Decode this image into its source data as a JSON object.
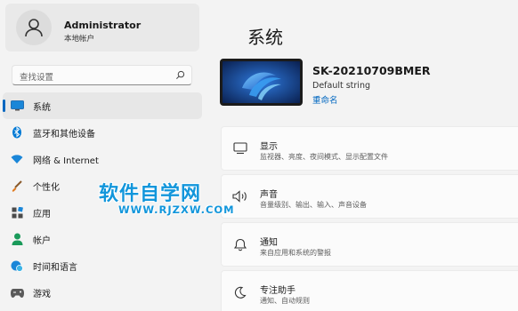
{
  "account": {
    "name": "Administrator",
    "type": "本地帐户"
  },
  "search": {
    "placeholder": "查找设置"
  },
  "nav": {
    "items": [
      {
        "label": "系统",
        "icon": "monitor-icon",
        "active": true
      },
      {
        "label": "蓝牙和其他设备",
        "icon": "bluetooth-icon",
        "active": false
      },
      {
        "label": "网络 & Internet",
        "icon": "wifi-icon",
        "active": false
      },
      {
        "label": "个性化",
        "icon": "brush-icon",
        "active": false
      },
      {
        "label": "应用",
        "icon": "apps-icon",
        "active": false
      },
      {
        "label": "帐户",
        "icon": "person-icon",
        "active": false
      },
      {
        "label": "时间和语言",
        "icon": "globe-clock-icon",
        "active": false
      },
      {
        "label": "游戏",
        "icon": "gamepad-icon",
        "active": false
      }
    ]
  },
  "main": {
    "title": "系统",
    "device": {
      "name": "SK-20210709BMER",
      "description": "Default string",
      "rename_label": "重命名"
    },
    "cards": [
      {
        "title": "显示",
        "subtitle": "监视器、亮度、夜间模式、显示配置文件",
        "icon": "display-icon"
      },
      {
        "title": "声音",
        "subtitle": "音量级别、输出、输入、声音设备",
        "icon": "speaker-icon"
      },
      {
        "title": "通知",
        "subtitle": "来自应用和系统的警报",
        "icon": "bell-icon"
      },
      {
        "title": "专注助手",
        "subtitle": "通知、自动规则",
        "icon": "moon-icon"
      }
    ]
  },
  "watermark": {
    "title": "软件自学网",
    "url": "WWW.RJZXW.COM"
  },
  "colors": {
    "accent": "#0067c0",
    "watermark": "#1296db",
    "background": "#f3f3f3",
    "card": "#fbfbfb"
  }
}
